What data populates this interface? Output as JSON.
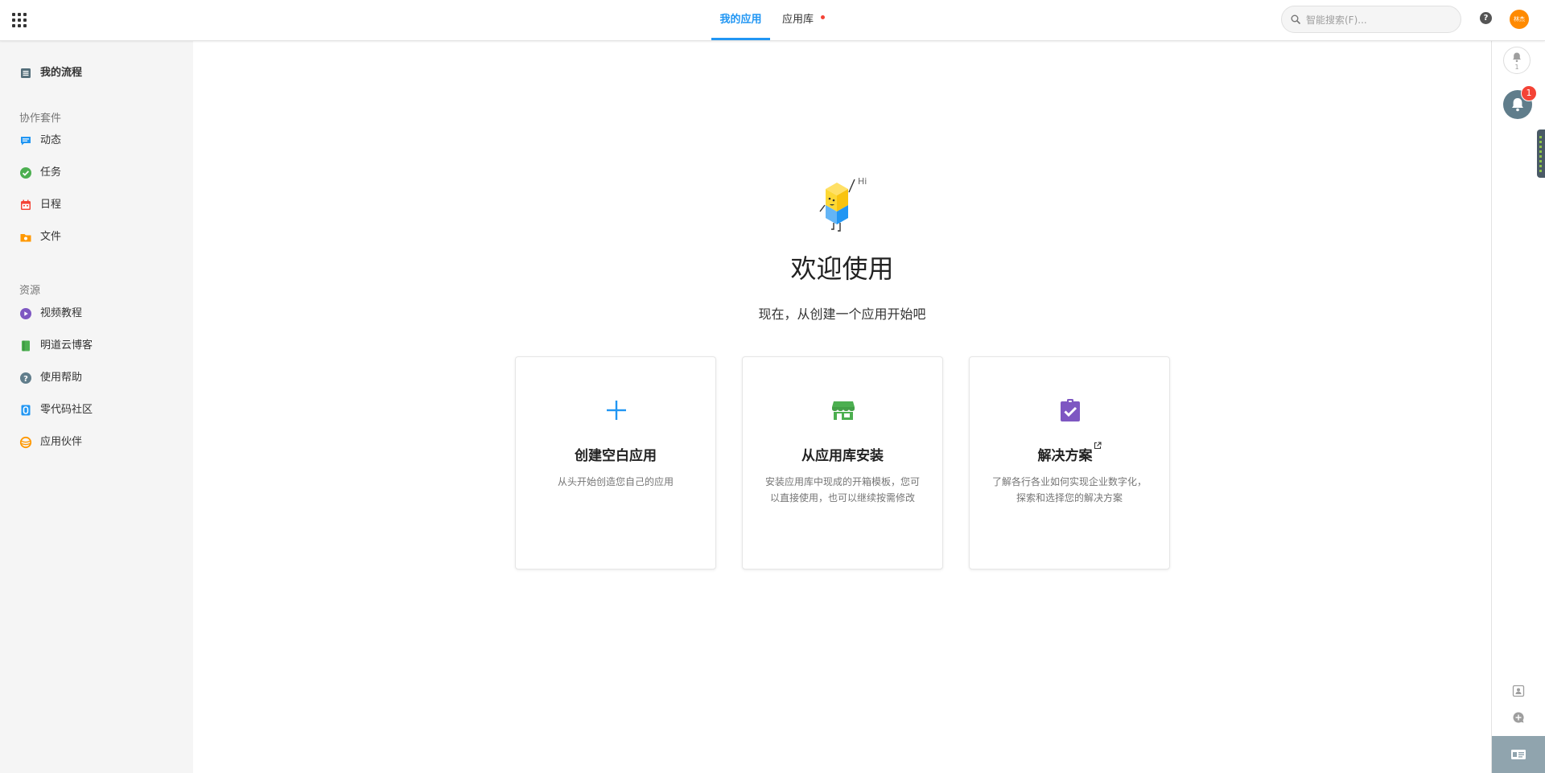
{
  "header": {
    "tabs": [
      {
        "label": "我的应用",
        "active": true
      },
      {
        "label": "应用库",
        "active": false,
        "has_dot": true
      }
    ],
    "search": {
      "placeholder": "智能搜索(F)...",
      "value": ""
    },
    "help_icon": "question-circle-icon",
    "avatar_text": "林杰",
    "avatar_color": "#ff8a00"
  },
  "sidebar": {
    "top_item": {
      "label": "我的流程",
      "icon": "process-list-icon"
    },
    "sections": [
      {
        "heading": "协作套件",
        "items": [
          {
            "label": "动态",
            "icon": "feed-icon",
            "color": "#2196f3"
          },
          {
            "label": "任务",
            "icon": "task-check-icon",
            "color": "#4caf50"
          },
          {
            "label": "日程",
            "icon": "calendar-icon",
            "color": "#f44336"
          },
          {
            "label": "文件",
            "icon": "folder-icon",
            "color": "#ff9800"
          }
        ]
      },
      {
        "heading": "资源",
        "items": [
          {
            "label": "视频教程",
            "icon": "video-play-icon",
            "color": "#7e57c2"
          },
          {
            "label": "明道云博客",
            "icon": "book-icon",
            "color": "#4caf50"
          },
          {
            "label": "使用帮助",
            "icon": "help-icon",
            "color": "#607d8b"
          },
          {
            "label": "零代码社区",
            "icon": "community-icon",
            "color": "#2196f3"
          },
          {
            "label": "应用伙伴",
            "icon": "partner-icon",
            "color": "#ff9800"
          }
        ]
      }
    ]
  },
  "main": {
    "mascot_text": "Hi",
    "title": "欢迎使用",
    "subtitle": "现在，从创建一个应用开始吧",
    "cards": [
      {
        "title": "创建空白应用",
        "desc": "从头开始创造您自己的应用",
        "icon": "plus-icon",
        "color": "#2196f3"
      },
      {
        "title": "从应用库安装",
        "desc": "安装应用库中现成的开箱模板，您可以直接使用，也可以继续按需修改",
        "icon": "store-icon",
        "color": "#4caf50"
      },
      {
        "title": "解决方案",
        "desc": "了解各行各业如何实现企业数字化，探索和选择您的解决方案",
        "icon": "clipboard-check-icon",
        "color": "#7e57c2",
        "external": true
      }
    ]
  },
  "rail": {
    "bell_outline_count": "1",
    "notification_badge": "1"
  }
}
